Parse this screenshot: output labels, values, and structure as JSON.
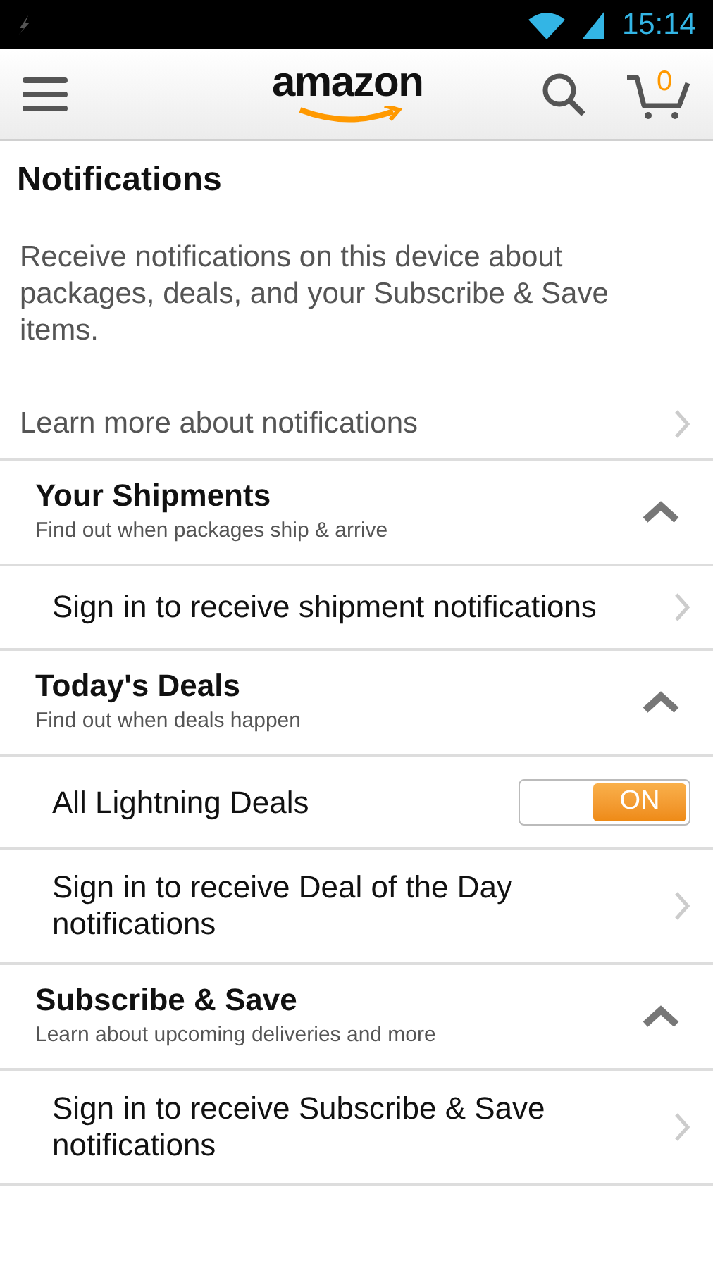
{
  "status_bar": {
    "time": "15:14"
  },
  "header": {
    "logo": "amazon",
    "cart_count": "0"
  },
  "title": "Notifications",
  "description": "Receive notifications on this device about packages, deals, and your Subscribe & Save items.",
  "learn_more": "Learn more about notifications",
  "sections": [
    {
      "title": "Your Shipments",
      "subtitle": "Find out when packages ship & arrive",
      "expanded": true,
      "items": [
        {
          "kind": "link",
          "label": "Sign in to receive shipment notifications"
        }
      ]
    },
    {
      "title": "Today's Deals",
      "subtitle": "Find out when deals happen",
      "expanded": true,
      "items": [
        {
          "kind": "toggle",
          "label": "All Lightning Deals",
          "on": true,
          "state_label": "ON"
        },
        {
          "kind": "link",
          "label": "Sign in to receive Deal of the Day notifications"
        }
      ]
    },
    {
      "title": "Subscribe & Save",
      "subtitle": "Learn about upcoming deliveries and more",
      "expanded": true,
      "items": [
        {
          "kind": "link",
          "label": "Sign in to receive Subscribe & Save notifications"
        }
      ]
    }
  ]
}
